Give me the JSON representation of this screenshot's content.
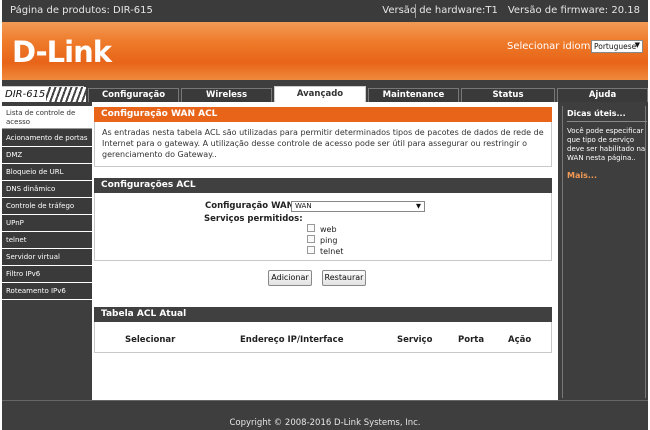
{
  "topbar": {
    "product": "Página de produtos: DIR-615",
    "hardware": "Versão de hardware:T1",
    "firmware": "Versão de firmware: 20.18"
  },
  "banner": {
    "logo": "D-Link",
    "language_label": "Selecionar idioma",
    "language_value": "Portuguese"
  },
  "nav": {
    "model": "DIR-615",
    "tabs": [
      {
        "label": "Configuração"
      },
      {
        "label": "Wireless"
      },
      {
        "label": "Avançado",
        "active": true
      },
      {
        "label": "Maintenance"
      },
      {
        "label": "Status"
      },
      {
        "label": "Ajuda"
      }
    ]
  },
  "sidebar": {
    "items": [
      {
        "label": "Lista de controle de acesso",
        "active": true
      },
      {
        "label": "Acionamento de portas"
      },
      {
        "label": "DMZ"
      },
      {
        "label": "Bloqueio de URL"
      },
      {
        "label": "DNS dinâmico"
      },
      {
        "label": "Controle de tráfego"
      },
      {
        "label": "UPnP"
      },
      {
        "label": "telnet"
      },
      {
        "label": "Servidor virtual"
      },
      {
        "label": "Filtro IPv6"
      },
      {
        "label": "Roteamento IPv6"
      }
    ]
  },
  "main": {
    "title": "Configuração WAN ACL",
    "intro": "As entradas nesta tabela ACL são utilizadas para permitir determinados tipos de pacotes de dados de rede de Internet para o gateway.   A utilização desse controle de acesso pode ser útil para assegurar ou restringir o gerenciamento do Gateway..",
    "acl_section": "Configurações ACL",
    "wan_label": "Configuração WAN:",
    "wan_value": "WAN",
    "services_label": "Serviços permitidos:",
    "services": [
      {
        "label": "web",
        "checked": false
      },
      {
        "label": "ping",
        "checked": false
      },
      {
        "label": "telnet",
        "checked": false
      }
    ],
    "add_button": "Adicionar",
    "reset_button": "Restaurar",
    "table_section": "Tabela ACL Atual",
    "table_headers": [
      "Selecionar",
      "Endereço IP/Interface",
      "Serviço",
      "Porta",
      "Ação"
    ]
  },
  "help": {
    "title": "Dicas úteis...",
    "text": "Você pode especificar que tipo de serviço deve ser habilitado na WAN nesta página..",
    "more": "Mais..."
  },
  "footer": {
    "copyright": "Copyright © 2008-2016 D-Link Systems, Inc."
  }
}
